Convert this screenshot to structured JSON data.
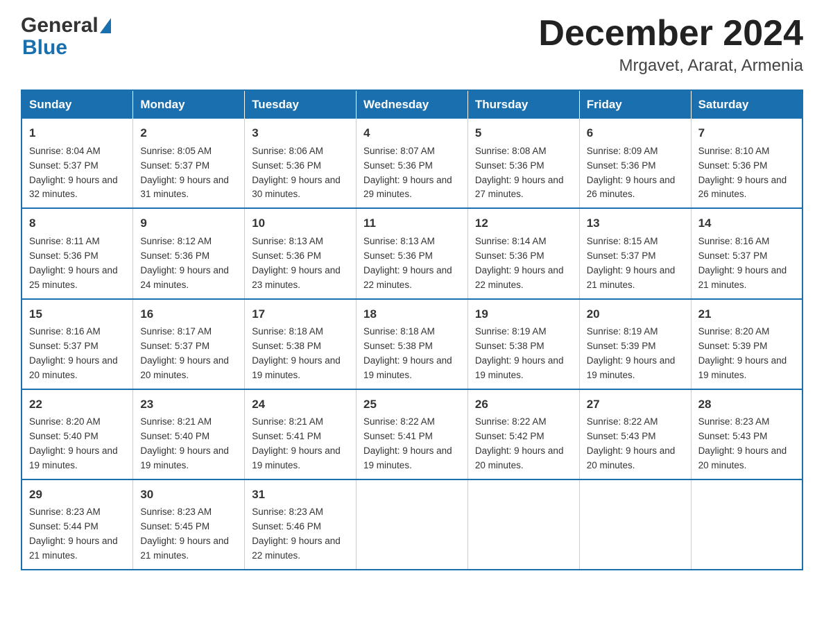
{
  "logo": {
    "general": "General",
    "blue": "Blue"
  },
  "title": "December 2024",
  "subtitle": "Mrgavet, Ararat, Armenia",
  "days_of_week": [
    "Sunday",
    "Monday",
    "Tuesday",
    "Wednesday",
    "Thursday",
    "Friday",
    "Saturday"
  ],
  "weeks": [
    [
      {
        "day": "1",
        "sunrise": "Sunrise: 8:04 AM",
        "sunset": "Sunset: 5:37 PM",
        "daylight": "Daylight: 9 hours and 32 minutes."
      },
      {
        "day": "2",
        "sunrise": "Sunrise: 8:05 AM",
        "sunset": "Sunset: 5:37 PM",
        "daylight": "Daylight: 9 hours and 31 minutes."
      },
      {
        "day": "3",
        "sunrise": "Sunrise: 8:06 AM",
        "sunset": "Sunset: 5:36 PM",
        "daylight": "Daylight: 9 hours and 30 minutes."
      },
      {
        "day": "4",
        "sunrise": "Sunrise: 8:07 AM",
        "sunset": "Sunset: 5:36 PM",
        "daylight": "Daylight: 9 hours and 29 minutes."
      },
      {
        "day": "5",
        "sunrise": "Sunrise: 8:08 AM",
        "sunset": "Sunset: 5:36 PM",
        "daylight": "Daylight: 9 hours and 27 minutes."
      },
      {
        "day": "6",
        "sunrise": "Sunrise: 8:09 AM",
        "sunset": "Sunset: 5:36 PM",
        "daylight": "Daylight: 9 hours and 26 minutes."
      },
      {
        "day": "7",
        "sunrise": "Sunrise: 8:10 AM",
        "sunset": "Sunset: 5:36 PM",
        "daylight": "Daylight: 9 hours and 26 minutes."
      }
    ],
    [
      {
        "day": "8",
        "sunrise": "Sunrise: 8:11 AM",
        "sunset": "Sunset: 5:36 PM",
        "daylight": "Daylight: 9 hours and 25 minutes."
      },
      {
        "day": "9",
        "sunrise": "Sunrise: 8:12 AM",
        "sunset": "Sunset: 5:36 PM",
        "daylight": "Daylight: 9 hours and 24 minutes."
      },
      {
        "day": "10",
        "sunrise": "Sunrise: 8:13 AM",
        "sunset": "Sunset: 5:36 PM",
        "daylight": "Daylight: 9 hours and 23 minutes."
      },
      {
        "day": "11",
        "sunrise": "Sunrise: 8:13 AM",
        "sunset": "Sunset: 5:36 PM",
        "daylight": "Daylight: 9 hours and 22 minutes."
      },
      {
        "day": "12",
        "sunrise": "Sunrise: 8:14 AM",
        "sunset": "Sunset: 5:36 PM",
        "daylight": "Daylight: 9 hours and 22 minutes."
      },
      {
        "day": "13",
        "sunrise": "Sunrise: 8:15 AM",
        "sunset": "Sunset: 5:37 PM",
        "daylight": "Daylight: 9 hours and 21 minutes."
      },
      {
        "day": "14",
        "sunrise": "Sunrise: 8:16 AM",
        "sunset": "Sunset: 5:37 PM",
        "daylight": "Daylight: 9 hours and 21 minutes."
      }
    ],
    [
      {
        "day": "15",
        "sunrise": "Sunrise: 8:16 AM",
        "sunset": "Sunset: 5:37 PM",
        "daylight": "Daylight: 9 hours and 20 minutes."
      },
      {
        "day": "16",
        "sunrise": "Sunrise: 8:17 AM",
        "sunset": "Sunset: 5:37 PM",
        "daylight": "Daylight: 9 hours and 20 minutes."
      },
      {
        "day": "17",
        "sunrise": "Sunrise: 8:18 AM",
        "sunset": "Sunset: 5:38 PM",
        "daylight": "Daylight: 9 hours and 19 minutes."
      },
      {
        "day": "18",
        "sunrise": "Sunrise: 8:18 AM",
        "sunset": "Sunset: 5:38 PM",
        "daylight": "Daylight: 9 hours and 19 minutes."
      },
      {
        "day": "19",
        "sunrise": "Sunrise: 8:19 AM",
        "sunset": "Sunset: 5:38 PM",
        "daylight": "Daylight: 9 hours and 19 minutes."
      },
      {
        "day": "20",
        "sunrise": "Sunrise: 8:19 AM",
        "sunset": "Sunset: 5:39 PM",
        "daylight": "Daylight: 9 hours and 19 minutes."
      },
      {
        "day": "21",
        "sunrise": "Sunrise: 8:20 AM",
        "sunset": "Sunset: 5:39 PM",
        "daylight": "Daylight: 9 hours and 19 minutes."
      }
    ],
    [
      {
        "day": "22",
        "sunrise": "Sunrise: 8:20 AM",
        "sunset": "Sunset: 5:40 PM",
        "daylight": "Daylight: 9 hours and 19 minutes."
      },
      {
        "day": "23",
        "sunrise": "Sunrise: 8:21 AM",
        "sunset": "Sunset: 5:40 PM",
        "daylight": "Daylight: 9 hours and 19 minutes."
      },
      {
        "day": "24",
        "sunrise": "Sunrise: 8:21 AM",
        "sunset": "Sunset: 5:41 PM",
        "daylight": "Daylight: 9 hours and 19 minutes."
      },
      {
        "day": "25",
        "sunrise": "Sunrise: 8:22 AM",
        "sunset": "Sunset: 5:41 PM",
        "daylight": "Daylight: 9 hours and 19 minutes."
      },
      {
        "day": "26",
        "sunrise": "Sunrise: 8:22 AM",
        "sunset": "Sunset: 5:42 PM",
        "daylight": "Daylight: 9 hours and 20 minutes."
      },
      {
        "day": "27",
        "sunrise": "Sunrise: 8:22 AM",
        "sunset": "Sunset: 5:43 PM",
        "daylight": "Daylight: 9 hours and 20 minutes."
      },
      {
        "day": "28",
        "sunrise": "Sunrise: 8:23 AM",
        "sunset": "Sunset: 5:43 PM",
        "daylight": "Daylight: 9 hours and 20 minutes."
      }
    ],
    [
      {
        "day": "29",
        "sunrise": "Sunrise: 8:23 AM",
        "sunset": "Sunset: 5:44 PM",
        "daylight": "Daylight: 9 hours and 21 minutes."
      },
      {
        "day": "30",
        "sunrise": "Sunrise: 8:23 AM",
        "sunset": "Sunset: 5:45 PM",
        "daylight": "Daylight: 9 hours and 21 minutes."
      },
      {
        "day": "31",
        "sunrise": "Sunrise: 8:23 AM",
        "sunset": "Sunset: 5:46 PM",
        "daylight": "Daylight: 9 hours and 22 minutes."
      },
      null,
      null,
      null,
      null
    ]
  ]
}
